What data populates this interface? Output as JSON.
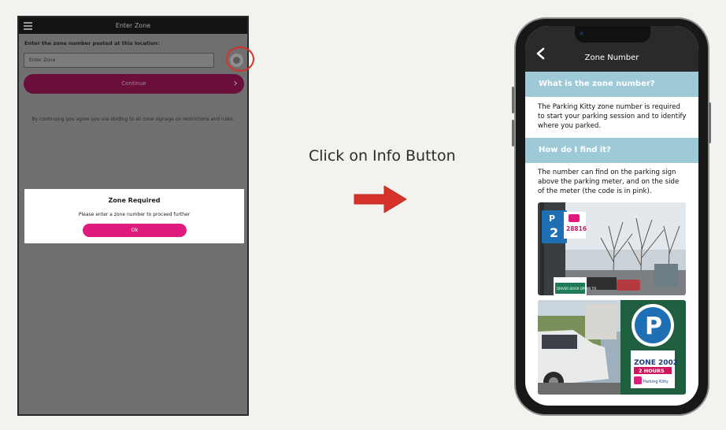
{
  "left_screen": {
    "title": "Enter Zone",
    "zone_label": "Enter the zone number posted at this location:",
    "zone_placeholder": "Enter Zone",
    "continue_label": "Continue",
    "agree_text": "By continuing you agree you are abiding to all zone signage on restrictions and rules.",
    "dialog": {
      "title": "Zone Required",
      "message": "Please enter a zone number to proceed further",
      "ok_label": "Ok"
    }
  },
  "middle": {
    "caption": "Click on Info Button"
  },
  "phone": {
    "title": "Zone Number",
    "sections": [
      {
        "heading": "What is the zone number?",
        "body": "The Parking Kitty zone number is required to start your parking session and to identify where you parked."
      },
      {
        "heading": "How do I find it?",
        "body": "The number can find on the parking sign above the parking meter, and on the side of the meter (the code is in pink)."
      }
    ],
    "photo1": {
      "sign_number": "2",
      "sign_code": "28816",
      "door_text": "DRIVER DOOR OPENS TO"
    },
    "photo2": {
      "zone": "ZONE 2002",
      "hours": "2 HOURS",
      "app": "Parking Kitty"
    }
  },
  "colors": {
    "accent_pink": "#df1b7d",
    "section_blue": "#9dcad6",
    "arrow_red": "#d6322a",
    "header_dark": "#2a2a2a"
  },
  "icons": [
    "hamburger-icon",
    "info-icon",
    "chevron-right-icon",
    "back-chevron-icon",
    "arrow-right-icon"
  ]
}
